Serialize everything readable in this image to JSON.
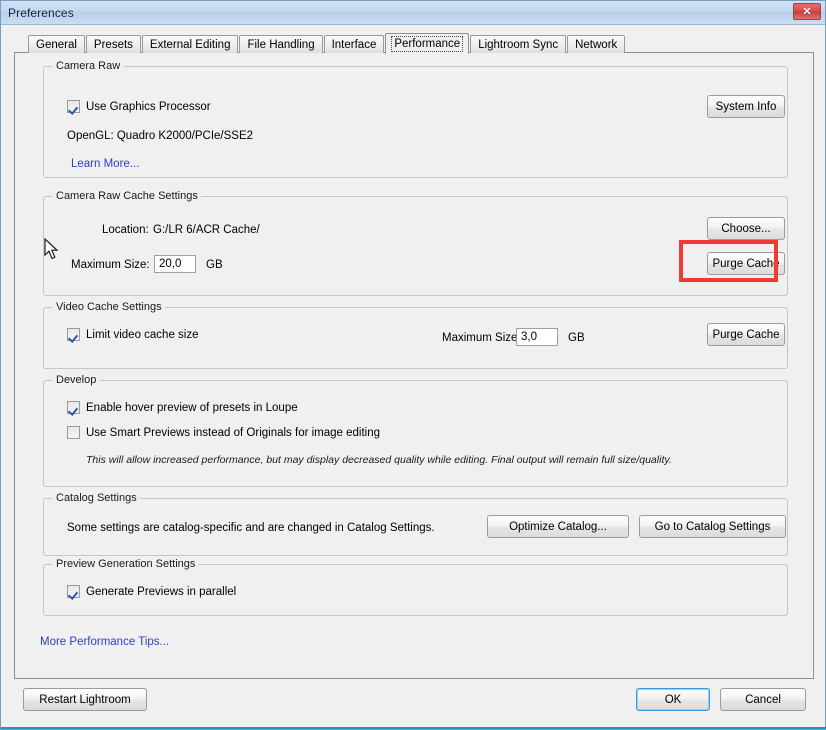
{
  "window": {
    "title": "Preferences",
    "close_label": "✕",
    "close_icon": "close-icon"
  },
  "tabs": [
    {
      "label": "General",
      "active": false
    },
    {
      "label": "Presets",
      "active": false
    },
    {
      "label": "External Editing",
      "active": false
    },
    {
      "label": "File Handling",
      "active": false
    },
    {
      "label": "Interface",
      "active": false
    },
    {
      "label": "Performance",
      "active": true
    },
    {
      "label": "Lightroom Sync",
      "active": false
    },
    {
      "label": "Network",
      "active": false
    }
  ],
  "groups": {
    "camera_raw": {
      "legend": "Camera Raw",
      "use_gpu_label": "Use Graphics Processor",
      "use_gpu_checked": true,
      "opengl_text": "OpenGL: Quadro K2000/PCIe/SSE2",
      "learn_more_label": "Learn More...",
      "system_info_label": "System Info"
    },
    "camera_raw_cache": {
      "legend": "Camera Raw Cache Settings",
      "location_label": "Location:",
      "location_value": "G:/LR 6/ACR Cache/",
      "max_size_label": "Maximum Size:",
      "max_size_value": "20,0",
      "unit_label": "GB",
      "choose_label": "Choose...",
      "purge_label": "Purge Cache"
    },
    "video_cache": {
      "legend": "Video Cache Settings",
      "limit_label": "Limit video cache size",
      "limit_checked": true,
      "max_size_label": "Maximum Size:",
      "max_size_value": "3,0",
      "unit_label": "GB",
      "purge_label": "Purge Cache"
    },
    "develop": {
      "legend": "Develop",
      "hover_preview_label": "Enable hover preview of presets in Loupe",
      "hover_preview_checked": true,
      "smart_previews_label": "Use Smart Previews instead of Originals for image editing",
      "smart_previews_checked": false,
      "hint": "This will allow increased performance, but may display decreased quality while editing. Final output will remain full size/quality."
    },
    "catalog": {
      "legend": "Catalog Settings",
      "description": "Some settings are catalog-specific and are changed in Catalog Settings.",
      "optimize_label": "Optimize Catalog...",
      "goto_label": "Go to Catalog Settings"
    },
    "preview_generation": {
      "legend": "Preview Generation Settings",
      "parallel_label": "Generate Previews in parallel",
      "parallel_checked": true
    }
  },
  "more_tips_label": "More Performance Tips...",
  "footer": {
    "restart_label": "Restart Lightroom",
    "ok_label": "OK",
    "cancel_label": "Cancel"
  },
  "annotation": {
    "color": "#ee3b33",
    "target": "purge-cache-button-camera-raw"
  },
  "colors": {
    "accent": "#2f8fc0",
    "link": "#2a3fd0",
    "titlebar": "#c3d8ef",
    "panel_bg": "#f0f0f0",
    "annotation": "#ee3b33",
    "close_button": "#d94b4b"
  }
}
